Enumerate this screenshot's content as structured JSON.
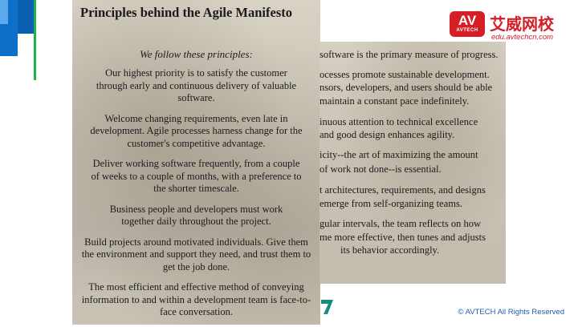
{
  "slide": {
    "left_page": {
      "title": "Principles behind the Agile Manifesto",
      "intro": "We follow these principles:",
      "principles": [
        "Our highest priority is to satisfy the customer through early and continuous delivery of valuable software.",
        "Welcome changing requirements, even late in development. Agile processes harness change for the customer's competitive advantage.",
        "Deliver working software frequently, from a couple of weeks to a couple of months, with a preference to the shorter timescale.",
        "Business people and developers must work together daily throughout the project.",
        "Build projects around motivated individuals. Give them the environment and support they need, and trust them to get the job done.",
        "The most efficient and effective method of conveying information to and within a development team is face-to-face conversation."
      ]
    },
    "right_page": {
      "lines": [
        "software is the primary measure of progress.",
        "ocesses promote sustainable development.",
        "nsors, developers, and users should be able",
        "maintain a constant pace indefinitely.",
        "inuous attention to technical excellence",
        "and good design enhances agility.",
        "icity--the art of maximizing the amount",
        "of work not done--is essential.",
        "t architectures, requirements, and designs",
        "emerge from self-organizing teams.",
        "gular intervals, the team reflects on how",
        "me more effective, then tunes and adjusts",
        "its behavior accordingly."
      ]
    },
    "logo": {
      "badge_text": "AV",
      "badge_sub": "AVTECH",
      "name_cn": "艾威网校",
      "url": "edu.avtechcn.com"
    },
    "copyright": "© AVTECH All Rights Reserved"
  }
}
